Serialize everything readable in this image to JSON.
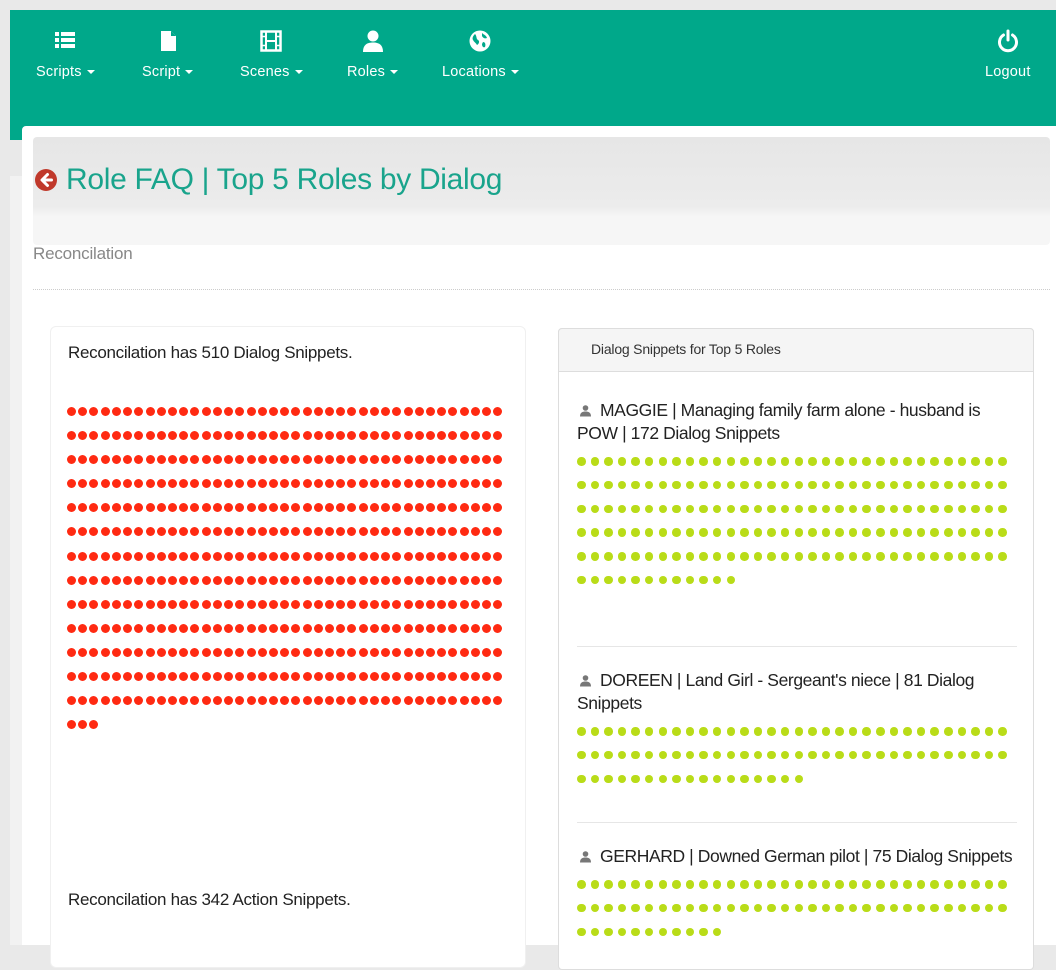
{
  "nav": {
    "items": [
      {
        "label": "Scripts",
        "icon": "list-icon"
      },
      {
        "label": "Script",
        "icon": "document-icon"
      },
      {
        "label": "Scenes",
        "icon": "film-icon"
      },
      {
        "label": "Roles",
        "icon": "user-icon"
      },
      {
        "label": "Locations",
        "icon": "globe-icon"
      }
    ],
    "logout": {
      "label": "Logout",
      "icon": "power-icon"
    }
  },
  "page": {
    "title": "Role FAQ | Top 5 Roles by Dialog",
    "subtitle": "Reconcilation"
  },
  "summary": {
    "dialog_text": "Reconcilation has 510 Dialog Snippets.",
    "dialog_count": 510,
    "action_text": "Reconcilation has 342 Action Snippets.",
    "action_count": 342
  },
  "top_roles": {
    "header": "Dialog Snippets for Top 5 Roles",
    "roles": [
      {
        "title": "MAGGIE | Managing family farm alone - husband is POW | 172 Dialog Snippets",
        "count": 172
      },
      {
        "title": "DOREEN | Land Girl - Sergeant's niece | 81 Dialog Snippets",
        "count": 81
      },
      {
        "title": "GERHARD | Downed German pilot | 75 Dialog Snippets",
        "count": 75
      }
    ]
  },
  "colors": {
    "nav_bg": "#00a88a",
    "title": "#19a48c",
    "dialog_dot": "#ff2a12",
    "role_dot": "#b9dc18",
    "back_icon": "#c0392b"
  }
}
